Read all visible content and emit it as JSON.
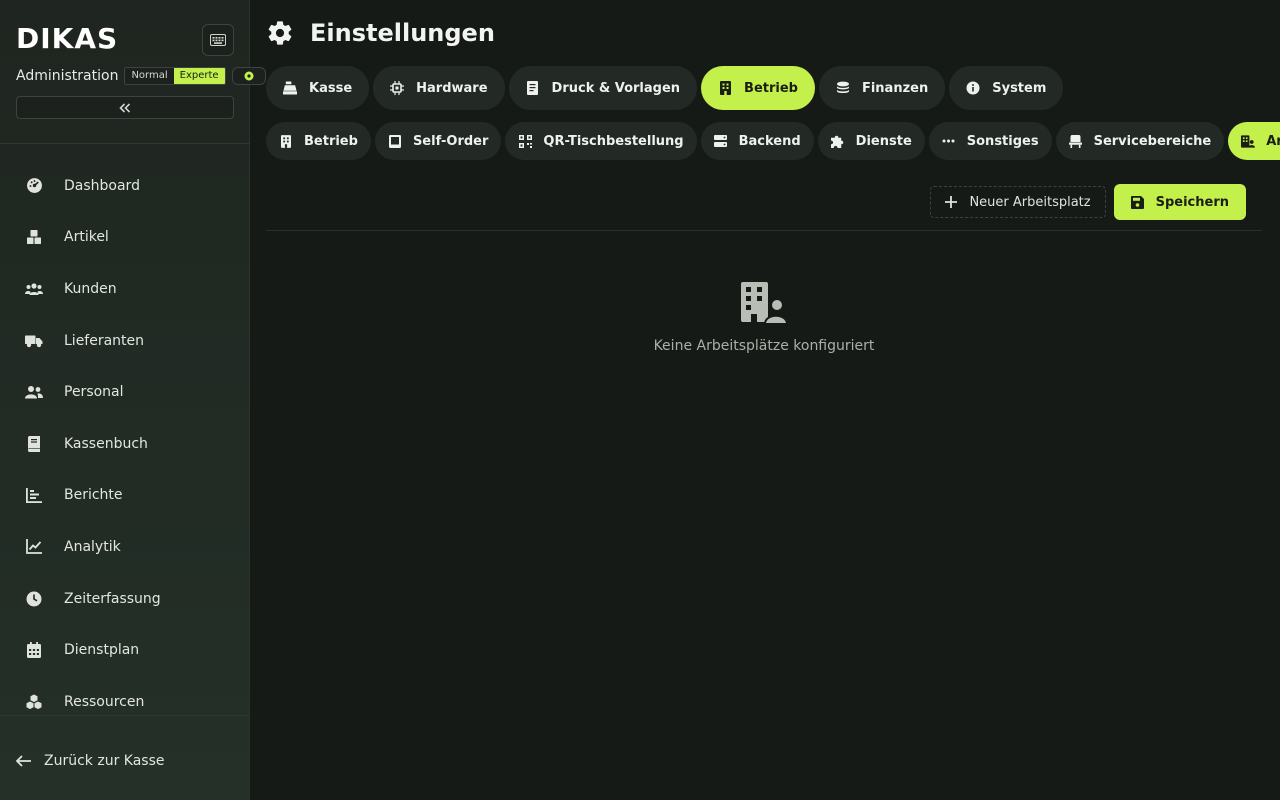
{
  "sidebar": {
    "logo": "DIKAS",
    "admin_label": "Administration",
    "modes": [
      "Normal",
      "Experte"
    ],
    "active_mode": "Experte",
    "nav": [
      {
        "label": "Dashboard",
        "icon": "dashboard-gauge-icon"
      },
      {
        "label": "Artikel",
        "icon": "boxes-icon"
      },
      {
        "label": "Kunden",
        "icon": "users-group-icon"
      },
      {
        "label": "Lieferanten",
        "icon": "truck-icon"
      },
      {
        "label": "Personal",
        "icon": "user-friends-icon"
      },
      {
        "label": "Kassenbuch",
        "icon": "book-icon"
      },
      {
        "label": "Berichte",
        "icon": "bar-chart-icon"
      },
      {
        "label": "Analytik",
        "icon": "line-chart-icon"
      },
      {
        "label": "Zeiterfassung",
        "icon": "clock-icon"
      },
      {
        "label": "Dienstplan",
        "icon": "calendar-icon"
      },
      {
        "label": "Ressourcen",
        "icon": "cubes-icon"
      }
    ],
    "back_label": "Zurück zur Kasse"
  },
  "header": {
    "title": "Einstellungen"
  },
  "primary_tabs": [
    {
      "label": "Kasse",
      "icon": "cash-register-icon"
    },
    {
      "label": "Hardware",
      "icon": "microchip-icon"
    },
    {
      "label": "Druck & Vorlagen",
      "icon": "document-icon"
    },
    {
      "label": "Betrieb",
      "icon": "building-icon",
      "active": true
    },
    {
      "label": "Finanzen",
      "icon": "coins-icon"
    },
    {
      "label": "System",
      "icon": "info-circle-icon"
    }
  ],
  "secondary_tabs": [
    {
      "label": "Betrieb",
      "icon": "building-icon"
    },
    {
      "label": "Self-Order",
      "icon": "tablet-icon"
    },
    {
      "label": "QR-Tischbestellung",
      "icon": "qr-code-icon"
    },
    {
      "label": "Backend",
      "icon": "server-icon"
    },
    {
      "label": "Dienste",
      "icon": "puzzle-icon"
    },
    {
      "label": "Sonstiges",
      "icon": "ellipsis-icon"
    },
    {
      "label": "Servicebereiche",
      "icon": "chair-icon"
    },
    {
      "label": "Arbeitsplätze",
      "icon": "building-user-icon",
      "active": true
    }
  ],
  "actions": {
    "new_label": "Neuer Arbeitsplatz",
    "save_label": "Speichern"
  },
  "empty_state": {
    "text": "Keine Arbeitsplätze konfiguriert"
  },
  "colors": {
    "accent": "#c3f04a",
    "background": "#161a17",
    "sidebar": "#1f2520"
  }
}
